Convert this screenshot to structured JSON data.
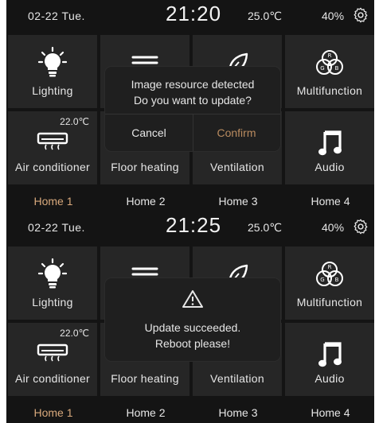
{
  "colors": {
    "accent": "#d8a97c",
    "confirm": "#b98b5f",
    "tile": "#262626",
    "bg": "#141414"
  },
  "screens": [
    {
      "status": {
        "date": "02-22  Tue.",
        "time": "21:20",
        "temperature": "25.0℃",
        "humidity": "40%",
        "settings_icon": "gear-icon"
      },
      "tiles": [
        {
          "label": "Lighting",
          "icon": "bulb-icon"
        },
        {
          "label": "",
          "icon": "curtain-icon"
        },
        {
          "label": "",
          "icon": "leaf-icon"
        },
        {
          "label": "Multifunction",
          "icon": "rgb-icon"
        },
        {
          "label": "Air conditioner",
          "icon": "ac-icon",
          "value": "22.0℃"
        },
        {
          "label": "Floor heating",
          "icon": "floor-icon"
        },
        {
          "label": "Ventilation",
          "icon": "fan-icon"
        },
        {
          "label": "Audio",
          "icon": "music-note-icon"
        }
      ],
      "homes": [
        "Home 1",
        "Home 2",
        "Home 3",
        "Home 4"
      ],
      "dialog": {
        "line1": "Image resource detected",
        "line2": "Do you want to update?",
        "cancel": "Cancel",
        "confirm": "Confirm"
      }
    },
    {
      "status": {
        "date": "02-22  Tue.",
        "time": "21:25",
        "temperature": "25.0℃",
        "humidity": "40%",
        "settings_icon": "gear-icon"
      },
      "tiles": [
        {
          "label": "Lighting",
          "icon": "bulb-icon"
        },
        {
          "label": "",
          "icon": "curtain-icon"
        },
        {
          "label": "",
          "icon": "leaf-icon"
        },
        {
          "label": "Multifunction",
          "icon": "rgb-icon"
        },
        {
          "label": "Air conditioner",
          "icon": "ac-icon",
          "value": "22.0℃"
        },
        {
          "label": "Floor heating",
          "icon": "floor-icon"
        },
        {
          "label": "Ventilation",
          "icon": "fan-icon"
        },
        {
          "label": "Audio",
          "icon": "music-note-icon"
        }
      ],
      "homes": [
        "Home 1",
        "Home 2",
        "Home 3",
        "Home 4"
      ],
      "dialog": {
        "icon": "warning-icon",
        "line1": "Update succeeded.",
        "line2": "Reboot please!"
      }
    }
  ]
}
